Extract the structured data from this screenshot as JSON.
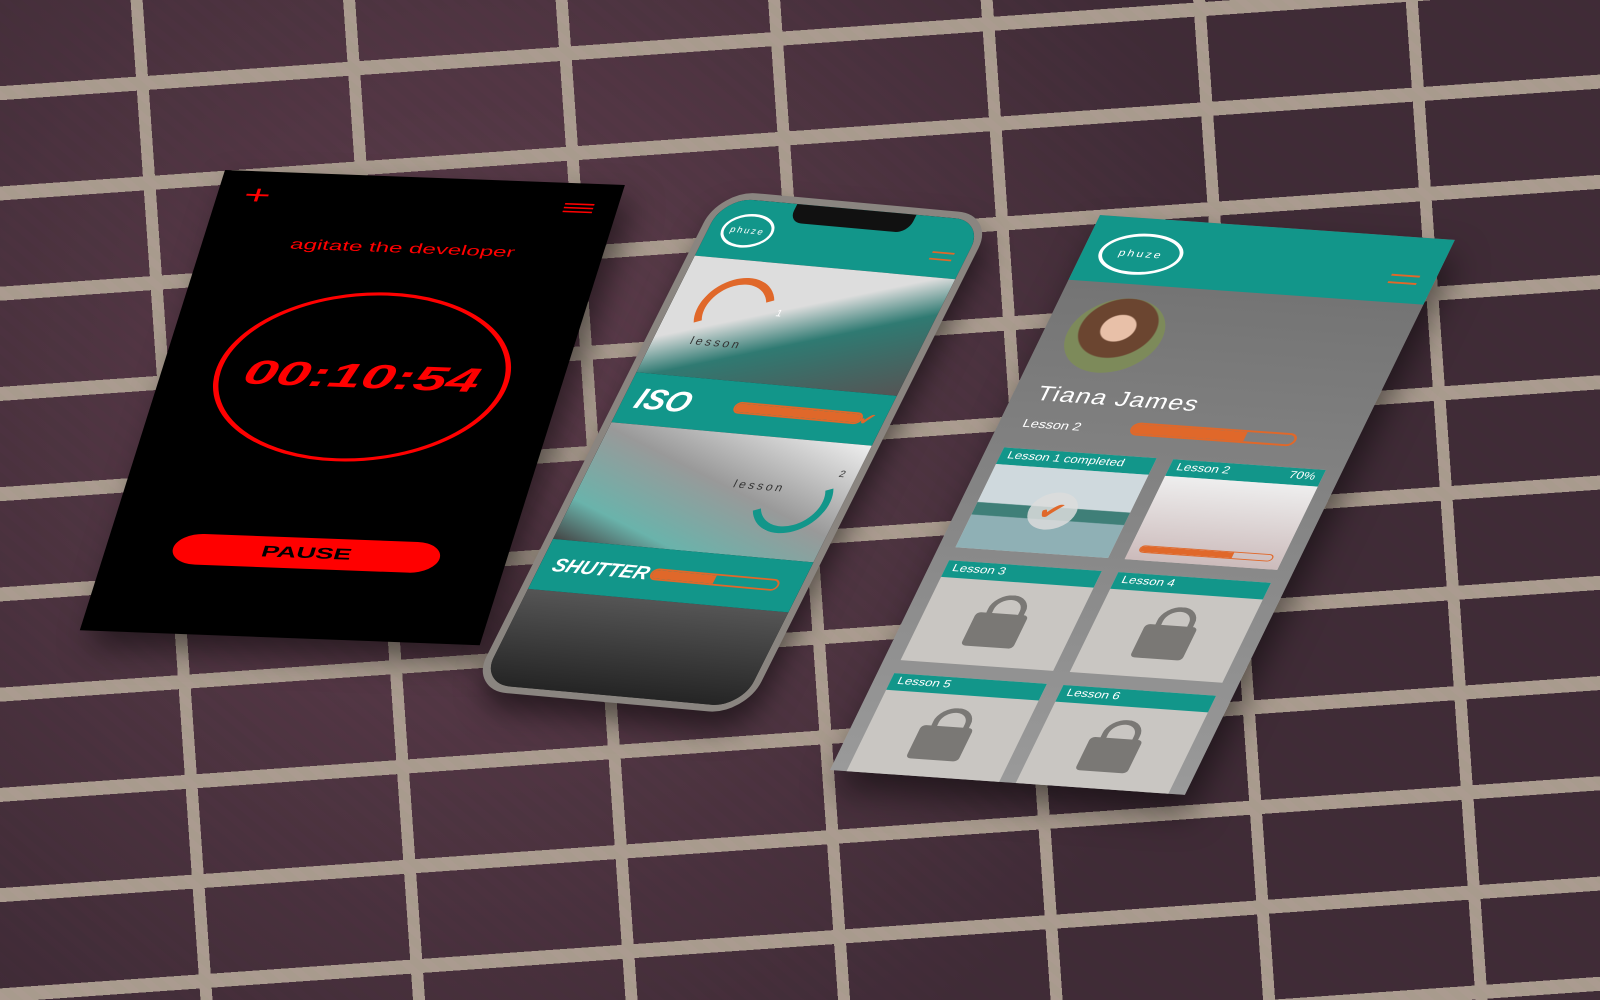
{
  "timer_screen": {
    "title": "agitate the developer",
    "time": "00:10:54",
    "pause_label": "PAUSE",
    "add_icon": "plus-icon",
    "menu_icon": "hamburger-icon",
    "color": "#ff0000"
  },
  "lesson_screen": {
    "logo": "phuze",
    "lessons": [
      {
        "number": "1",
        "word": "lesson",
        "topic": "ISO",
        "progress": 100,
        "completed": true
      },
      {
        "number": "2",
        "word": "lesson",
        "topic": "SHUTTER",
        "progress": 50,
        "completed": false
      }
    ],
    "accent": "#12968a",
    "orange": "#e0682a"
  },
  "profile_screen": {
    "logo": "phuze",
    "name": "Tiana James",
    "current_lesson": "Lesson 2",
    "progress": 70,
    "cards": [
      {
        "title": "Lesson 1 completed",
        "state": "completed"
      },
      {
        "title": "Lesson 2",
        "percent": "70%",
        "state": "in-progress"
      },
      {
        "title": "Lesson 3",
        "state": "locked"
      },
      {
        "title": "Lesson 4",
        "state": "locked"
      },
      {
        "title": "Lesson 5",
        "state": "locked"
      },
      {
        "title": "Lesson 6",
        "state": "locked"
      }
    ]
  }
}
